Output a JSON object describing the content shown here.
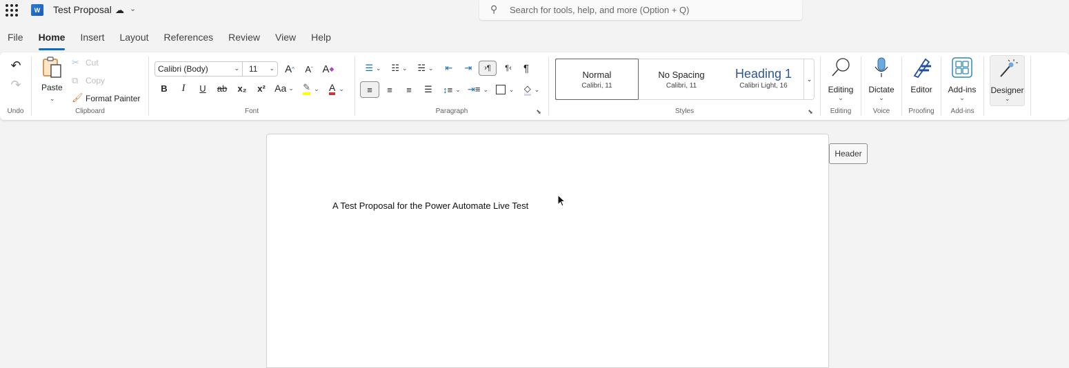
{
  "titlebar": {
    "app_icon": "word-logo",
    "app_letter": "W",
    "doc_title": "Test Proposal",
    "sync_icon": "cloud-saved-icon",
    "search_placeholder": "Search for tools, help, and more (Option + Q)"
  },
  "tabs": [
    {
      "label": "File",
      "active": false
    },
    {
      "label": "Home",
      "active": true
    },
    {
      "label": "Insert",
      "active": false
    },
    {
      "label": "Layout",
      "active": false
    },
    {
      "label": "References",
      "active": false
    },
    {
      "label": "Review",
      "active": false
    },
    {
      "label": "View",
      "active": false
    },
    {
      "label": "Help",
      "active": false
    }
  ],
  "ribbon": {
    "undo": {
      "group_label": "Undo",
      "undo_icon": "undo-icon",
      "redo_icon": "redo-icon"
    },
    "clipboard": {
      "group_label": "Clipboard",
      "paste": "Paste",
      "cut": "Cut",
      "copy": "Copy",
      "format_painter": "Format Painter"
    },
    "font": {
      "group_label": "Font",
      "font_name": "Calibri (Body)",
      "font_size": "11",
      "bold": "B",
      "italic": "I",
      "underline": "U",
      "strikethrough": "ab",
      "subscript": "x₂",
      "superscript": "x²",
      "change_case": "Aa",
      "highlight_color": "#ffff00",
      "font_color": "#d13438"
    },
    "paragraph": {
      "group_label": "Paragraph"
    },
    "styles": {
      "group_label": "Styles",
      "items": [
        {
          "name": "Normal",
          "sub": "Calibri, 11",
          "selected": true
        },
        {
          "name": "No Spacing",
          "sub": "Calibri, 11",
          "selected": false
        },
        {
          "name": "Heading 1",
          "sub": "Calibri Light, 16",
          "selected": false
        }
      ]
    },
    "editing": {
      "label": "Editing",
      "group_label": "Editing"
    },
    "voice": {
      "label": "Dictate",
      "group_label": "Voice"
    },
    "proofing": {
      "label": "Editor",
      "group_label": "Proofing"
    },
    "addins": {
      "label": "Add-ins",
      "group_label": "Add-ins"
    },
    "designer": {
      "label": "Designer"
    }
  },
  "document": {
    "body_text": "A Test Proposal for the Power Automate Live Test",
    "header_tag": "Header"
  },
  "colors": {
    "accent": "#0f6cbd",
    "heading_blue": "#2f5496"
  }
}
